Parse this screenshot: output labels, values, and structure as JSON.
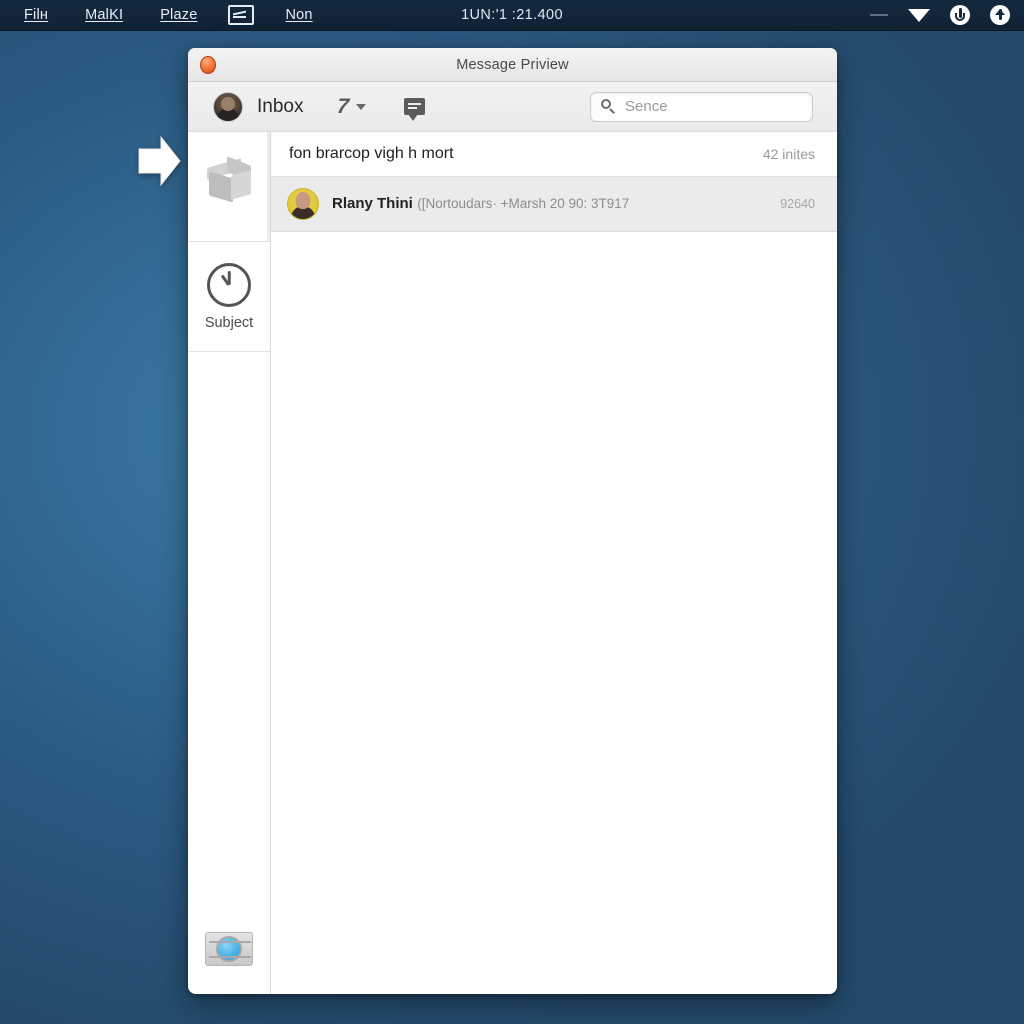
{
  "menubar": {
    "items": [
      {
        "label": "Filн",
        "name": "menu-file"
      },
      {
        "label": "MalKI",
        "name": "menu-mail"
      },
      {
        "label": "Plaze",
        "name": "menu-place"
      },
      {
        "label": "",
        "name": "menu-window-glyph"
      },
      {
        "label": "Non",
        "name": "menu-non"
      }
    ],
    "clock": "1UN:'1 :21.400",
    "tray": [
      {
        "name": "tray-dash-icon"
      },
      {
        "name": "tray-caret-down-icon"
      },
      {
        "name": "tray-power-icon"
      },
      {
        "name": "tray-upload-icon"
      }
    ]
  },
  "window": {
    "title": "Message Priview",
    "close_label": ""
  },
  "toolbar": {
    "mailbox_label": "Inbox",
    "sort_icon_glyph": "7",
    "search": {
      "placeholder": "Sence",
      "value": ""
    }
  },
  "sidebar": {
    "items": [
      {
        "label": "",
        "icon": "inbox-box-icon",
        "selected": true
      },
      {
        "label": "Subject",
        "icon": "clock-icon",
        "selected": false
      }
    ],
    "bottom_icon": "camera-icon"
  },
  "list": {
    "header_title": "fon brarcop vigh h mort",
    "header_count": "42 inites",
    "messages": [
      {
        "sender": "Rlany Thini",
        "snippet": "([Nortoudars· +Marsh 20 90: 3T917",
        "time": "92640"
      }
    ]
  },
  "colors": {
    "desktop_blue": "#336b96",
    "menubar_dark": "#132639",
    "accent_red": "#f2793a",
    "avatar_yellow": "#e0c93a",
    "camera_lens_blue": "#4db3e8"
  }
}
